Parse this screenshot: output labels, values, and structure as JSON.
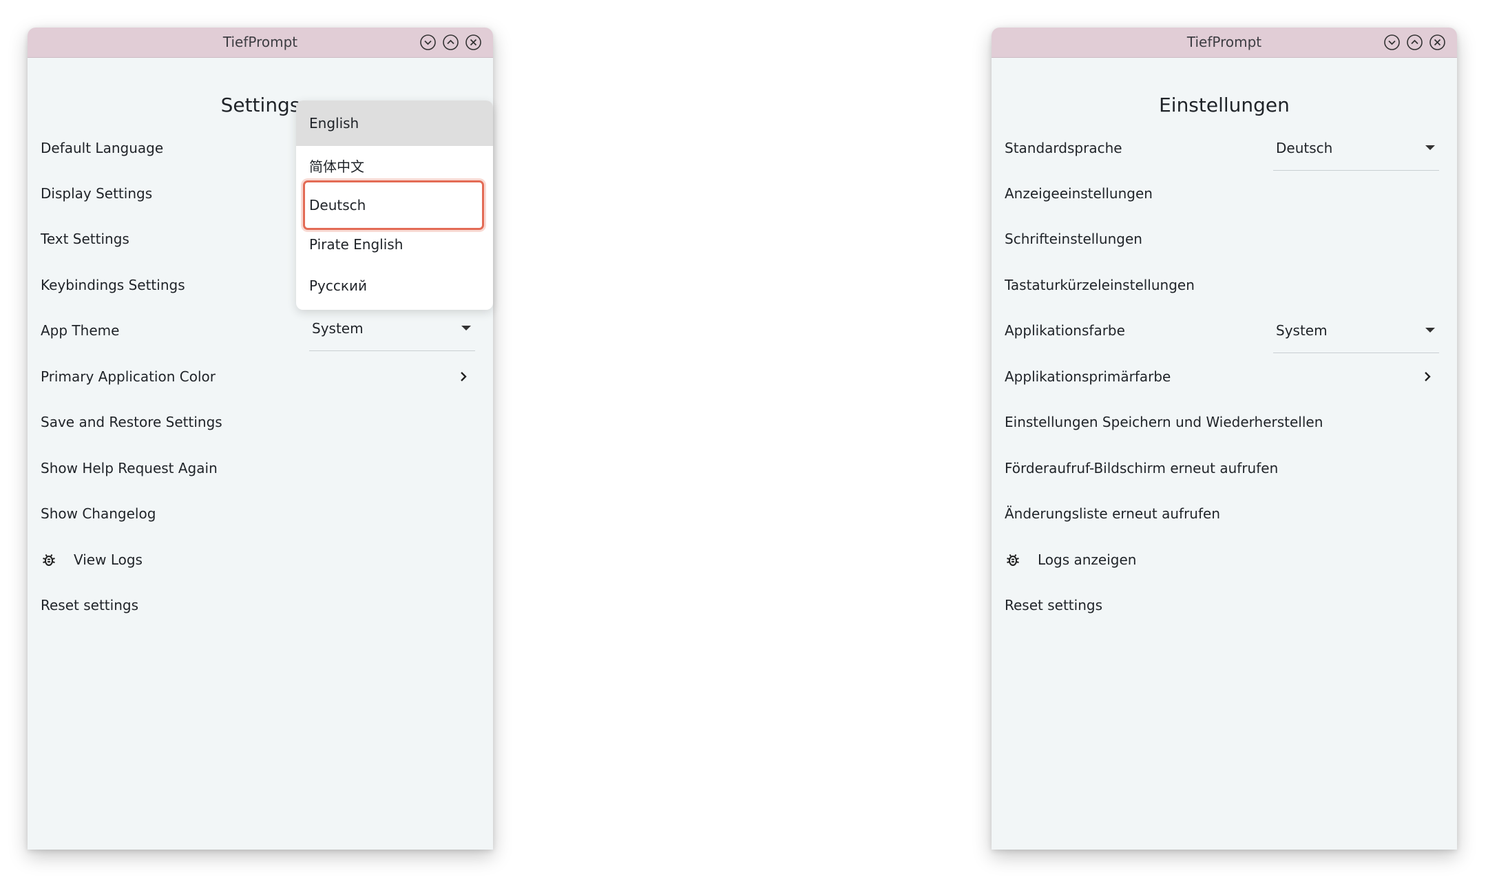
{
  "english_window": {
    "title": "TiefPrompt",
    "heading": "Settings",
    "rows": [
      {
        "label": "Default Language"
      },
      {
        "label": "Display Settings"
      },
      {
        "label": "Text Settings"
      },
      {
        "label": "Keybindings Settings"
      },
      {
        "label": "App Theme"
      },
      {
        "label": "Primary Application Color"
      },
      {
        "label": "Save and Restore Settings"
      },
      {
        "label": "Show Help Request Again"
      },
      {
        "label": "Show Changelog"
      },
      {
        "label": "View Logs",
        "icon": "bug-icon"
      },
      {
        "label": "Reset settings"
      }
    ],
    "app_theme_value": "System",
    "language_dropdown": {
      "options": [
        "English",
        "简体中文",
        "Deutsch",
        "Pirate English",
        "Русский"
      ],
      "selected": "English",
      "highlighted": "Deutsch",
      "highlight_color": "#e36b55"
    }
  },
  "german_window": {
    "title": "TiefPrompt",
    "heading": "Einstellungen",
    "rows": [
      {
        "label": "Standardsprache"
      },
      {
        "label": "Anzeigeeinstellungen"
      },
      {
        "label": "Schrifteinstellungen"
      },
      {
        "label": "Tastaturkürzeleinstellungen"
      },
      {
        "label": "Applikationsfarbe"
      },
      {
        "label": "Applikationsprimärfarbe"
      },
      {
        "label": "Einstellungen Speichern und Wiederherstellen"
      },
      {
        "label": "Förderaufruf-Bildschirm erneut aufrufen"
      },
      {
        "label": "Änderungsliste erneut aufrufen"
      },
      {
        "label": "Logs anzeigen",
        "icon": "bug-icon"
      },
      {
        "label": "Reset settings"
      }
    ],
    "language_value": "Deutsch",
    "app_theme_value": "System"
  },
  "colors": {
    "titlebar": "#e1cdd6",
    "window_background": "#f2f6f7",
    "dropdown_selected": "#dedede"
  }
}
